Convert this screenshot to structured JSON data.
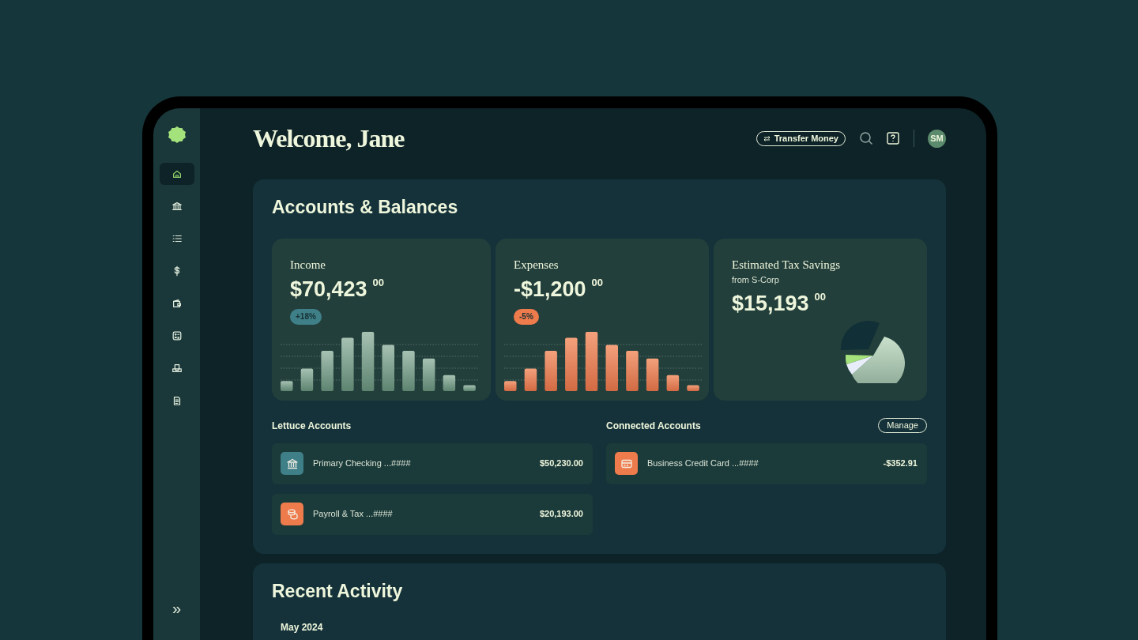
{
  "sidebar": {
    "items": [
      {
        "kind": "home",
        "selected": true
      },
      {
        "kind": "bank",
        "selected": false
      },
      {
        "kind": "list",
        "selected": false
      },
      {
        "kind": "dollar",
        "selected": false
      },
      {
        "kind": "wallet",
        "selected": false
      },
      {
        "kind": "calculator",
        "selected": false
      },
      {
        "kind": "inbox",
        "selected": false
      },
      {
        "kind": "document",
        "selected": false
      }
    ],
    "collapse": "»"
  },
  "header": {
    "greeting": "Welcome, Jane",
    "transfer_button": "Transfer Money",
    "avatar": "SM"
  },
  "accounts_panel": {
    "title": "Accounts & Balances",
    "cards": [
      {
        "kind": "income",
        "label": "Income",
        "amount": "$70,423",
        "cents": "00",
        "badge": "+18%",
        "color": "#3f7f88"
      },
      {
        "kind": "expense",
        "label": "Expenses",
        "amount": "-$1,200",
        "cents": "00",
        "badge": "-5%",
        "color": "#ee7b4c"
      },
      {
        "kind": "savings",
        "label": "Estimated Tax Savings",
        "subtitle": "from S-Corp",
        "amount": "$15,193",
        "cents": "00"
      }
    ],
    "lettuce": {
      "title": "Lettuce Accounts",
      "accounts": [
        {
          "kind": "bank",
          "name": "Primary Checking ...####",
          "balance": "$50,230.00",
          "color": "#3f7f88"
        },
        {
          "kind": "coins",
          "name": "Payroll & Tax ...####",
          "balance": "$20,193.00",
          "color": "#ee7b4c"
        }
      ]
    },
    "connected": {
      "title": "Connected Accounts",
      "manage_button": "Manage",
      "accounts": [
        {
          "kind": "card",
          "name": "Business Credit Card ...####",
          "balance": "-$352.91",
          "color": "#ee7b4c"
        }
      ]
    }
  },
  "recent_activity": {
    "title": "Recent Activity",
    "month": "May 2024"
  }
}
